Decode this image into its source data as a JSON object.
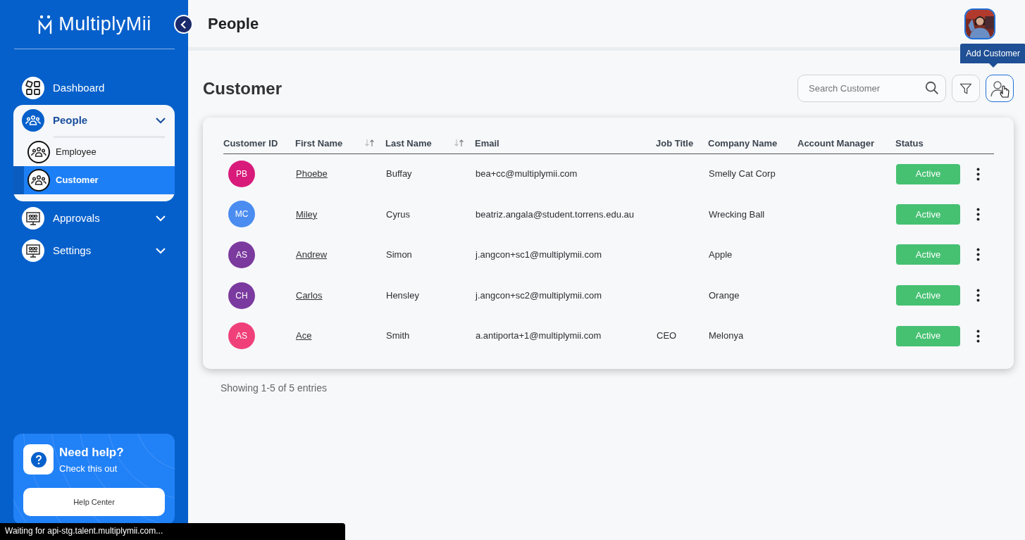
{
  "sidebar": {
    "logo": "MultiplyMii",
    "items": [
      {
        "label": "Dashboard",
        "kind": "link"
      },
      {
        "label": "People",
        "kind": "group",
        "expanded": true,
        "children": [
          {
            "label": "Employee",
            "selected": false
          },
          {
            "label": "Customer",
            "selected": true
          }
        ]
      },
      {
        "label": "Approvals",
        "kind": "group",
        "expanded": false
      },
      {
        "label": "Settings",
        "kind": "group",
        "expanded": false
      }
    ],
    "help": {
      "title": "Need help?",
      "subtitle": "Check this out",
      "button": "Help Center"
    }
  },
  "header": {
    "title": "People"
  },
  "page": {
    "title": "Customer",
    "search": {
      "placeholder": "Search Customer"
    },
    "tooltip": "Add Customer"
  },
  "table": {
    "columns": [
      {
        "label": "Customer ID",
        "sortable": false
      },
      {
        "label": "First Name",
        "sortable": true
      },
      {
        "label": "Last Name",
        "sortable": true
      },
      {
        "label": "Email",
        "sortable": false
      },
      {
        "label": "Job Title",
        "sortable": false
      },
      {
        "label": "Company Name",
        "sortable": false
      },
      {
        "label": "Account Manager",
        "sortable": false
      },
      {
        "label": "Status",
        "sortable": false
      }
    ],
    "rows": [
      {
        "initials": "PB",
        "color": "#d81b7b",
        "first_name": "Phoebe",
        "last_name": "Buffay",
        "email": "bea+cc@multiplymii.com",
        "company": "Smelly Cat Corp",
        "status": "Active"
      },
      {
        "initials": "MC",
        "color": "#4a8cf0",
        "first_name": "Miley",
        "last_name": "Cyrus",
        "email": "beatriz.angala@student.torrens.edu.au",
        "company": "Wrecking Ball",
        "status": "Active"
      },
      {
        "initials": "AS",
        "color": "#7b3a9e",
        "first_name": "Andrew",
        "last_name": "Simon",
        "email": "j.angcon+sc1@multiplymii.com",
        "company": "Apple",
        "status": "Active"
      },
      {
        "initials": "CH",
        "color": "#7b3a9f",
        "first_name": "Carlos",
        "last_name": "Hensley",
        "email": "j.angcon+sc2@multiplymii.com",
        "company": "Orange",
        "status": "Active"
      },
      {
        "initials": "AS",
        "color": "#f0407a",
        "first_name": "Ace",
        "last_name": "Smith",
        "email": "a.antiporta+1@multiplymii.com",
        "job_title": "CEO",
        "company": "Melonya",
        "status": "Active"
      }
    ],
    "footer": "Showing 1-5 of 5 entries"
  },
  "status_bar": "Waiting for api-stg.talent.multiplymii.com..."
}
